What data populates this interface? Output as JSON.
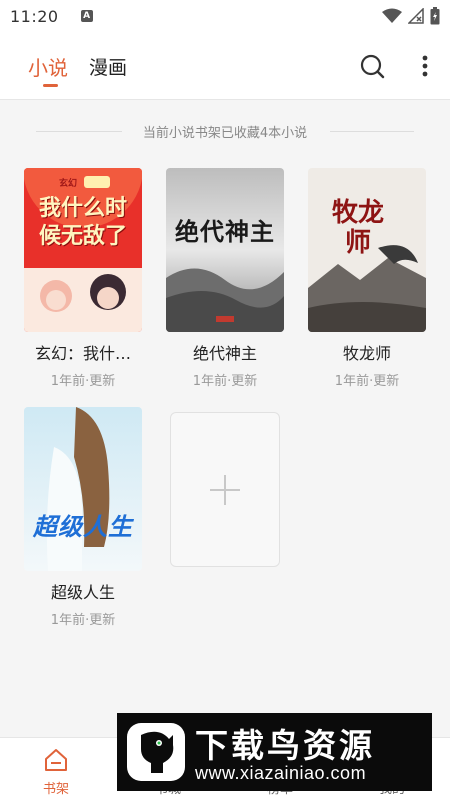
{
  "status_bar": {
    "time": "11:20",
    "notification_letter": "A"
  },
  "header": {
    "tabs": [
      {
        "label": "小说",
        "active": true
      },
      {
        "label": "漫画",
        "active": false
      }
    ],
    "search_icon": "search-icon",
    "more_icon": "more-vertical-icon"
  },
  "shelf": {
    "count_text": "当前小说书架已收藏4本小说",
    "books": [
      {
        "title": "玄幻：我什…",
        "meta": "1年前·更新",
        "cover_text": "我什么时候无敌了",
        "cover_badge": "玄幻"
      },
      {
        "title": "绝代神主",
        "meta": "1年前·更新",
        "cover_text": "绝代神主"
      },
      {
        "title": "牧龙师",
        "meta": "1年前·更新",
        "cover_text": "牧龙师"
      },
      {
        "title": "超级人生",
        "meta": "1年前·更新",
        "cover_text": "超级人生"
      }
    ],
    "add_icon": "plus-icon"
  },
  "bottom_nav": {
    "items": [
      {
        "label": "书架",
        "icon": "bookshelf-icon",
        "active": true
      },
      {
        "label": "书城",
        "icon": "store-icon",
        "active": false
      },
      {
        "label": "榜单",
        "icon": "rank-icon",
        "active": false
      },
      {
        "label": "我的",
        "icon": "profile-icon",
        "active": false
      }
    ]
  },
  "watermark": {
    "title": "下载鸟资源",
    "url": "www.xiazainiao.com"
  },
  "colors": {
    "accent": "#e0633a",
    "background": "#f5f5f5"
  }
}
